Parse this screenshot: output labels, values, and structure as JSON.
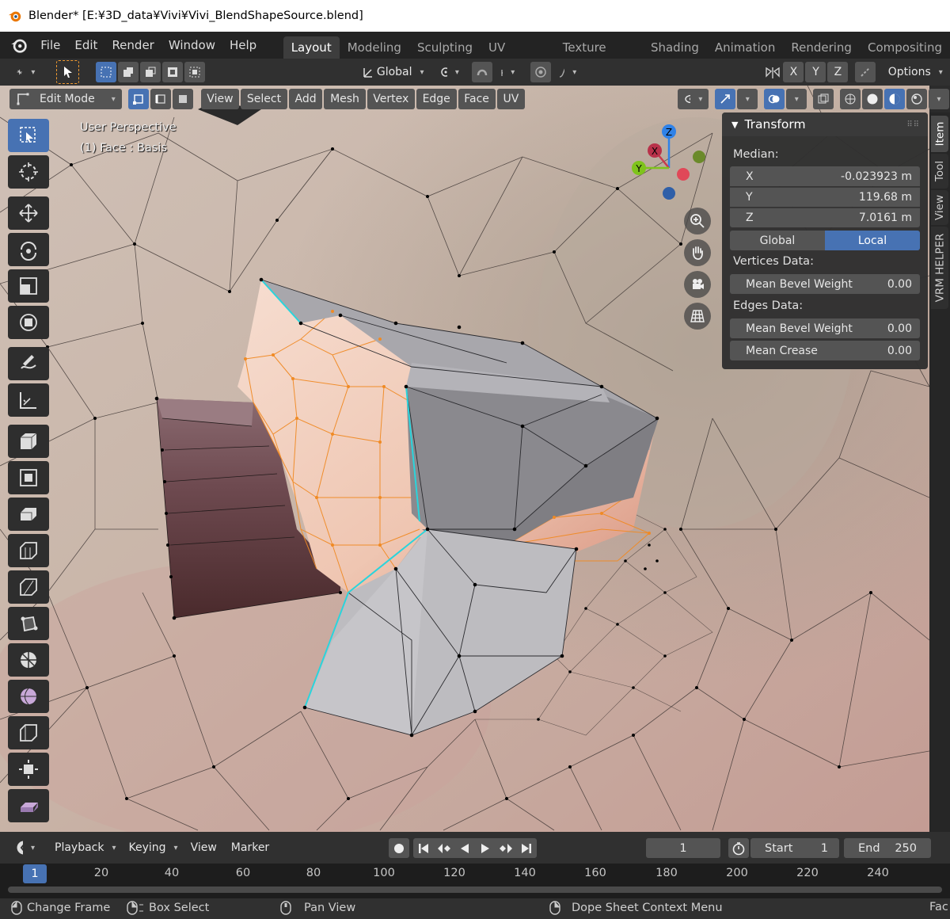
{
  "window": {
    "title": "Blender* [E:¥3D_data¥Vivi¥Vivi_BlendShapeSource.blend]"
  },
  "menu": {
    "items": [
      "File",
      "Edit",
      "Render",
      "Window",
      "Help"
    ],
    "workspaces": [
      "Layout",
      "Modeling",
      "Sculpting",
      "UV Editing",
      "Texture Paint",
      "Shading",
      "Animation",
      "Rendering",
      "Compositing"
    ],
    "active_workspace": "Layout"
  },
  "tool_header": {
    "orientation": "Global",
    "axes": [
      "X",
      "Y",
      "Z"
    ],
    "options_label": "Options"
  },
  "viewport_header": {
    "mode": "Edit Mode",
    "menus": [
      "View",
      "Select",
      "Add",
      "Mesh",
      "Vertex",
      "Edge",
      "Face",
      "UV"
    ]
  },
  "viewport": {
    "perspective_label": "User Perspective",
    "object_label": "(1) Face : Basis",
    "gizmo_axes": {
      "z": "Z",
      "x": "X",
      "y": "Y"
    }
  },
  "sidebar_tabs": [
    "Item",
    "Tool",
    "View",
    "VRM HELPER"
  ],
  "transform_panel": {
    "title": "Transform",
    "median_label": "Median:",
    "x_label": "X",
    "x_value": "-0.023923 m",
    "y_label": "Y",
    "y_value": "119.68 m",
    "z_label": "Z",
    "z_value": "7.0161 m",
    "global_label": "Global",
    "local_label": "Local",
    "active_space": "Local",
    "vertices_data_label": "Vertices Data:",
    "vertex_bevel_label": "Mean Bevel Weight",
    "vertex_bevel_value": "0.00",
    "edges_data_label": "Edges Data:",
    "edge_bevel_label": "Mean Bevel Weight",
    "edge_bevel_value": "0.00",
    "crease_label": "Mean Crease",
    "crease_value": "0.00"
  },
  "timeline": {
    "menus": [
      "Playback",
      "Keying",
      "View",
      "Marker"
    ],
    "current_frame": "1",
    "start_label": "Start",
    "start_value": "1",
    "end_label": "End",
    "end_value": "250",
    "ruler_current": "1",
    "ruler_ticks": [
      "20",
      "40",
      "60",
      "80",
      "100",
      "120",
      "140",
      "160",
      "180",
      "200",
      "220",
      "240"
    ]
  },
  "status_bar": {
    "change_frame": "Change Frame",
    "box_select": "Box Select",
    "pan_view": "Pan View",
    "context_menu": "Dope Sheet Context Menu",
    "truncated": "Fac"
  },
  "colors": {
    "accent": "#4772b3",
    "select_orange": "#f08a24",
    "edge_cyan": "#2ad4dc",
    "gizmo_x": "#c83a4e",
    "gizmo_y": "#7fc31c",
    "gizmo_z": "#2f82e8"
  }
}
